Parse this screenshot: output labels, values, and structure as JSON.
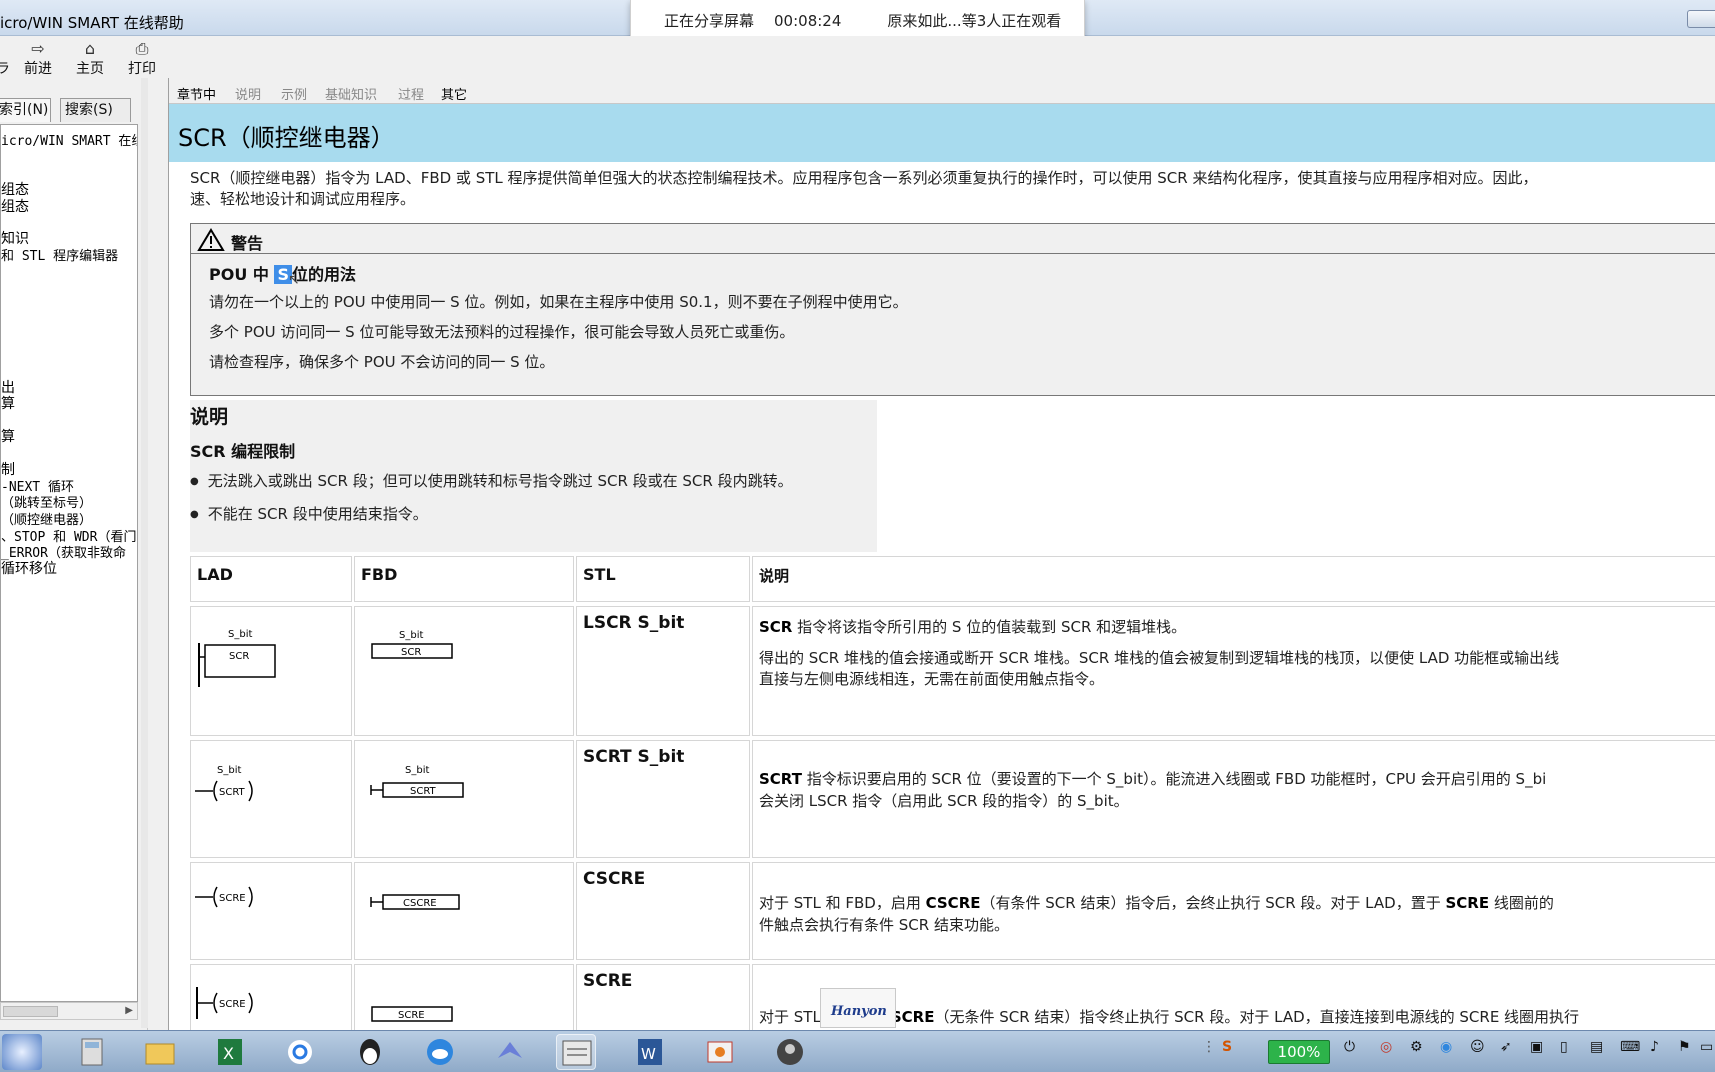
{
  "window": {
    "title": "icro/WIN SMART 在线帮助"
  },
  "share_bar": {
    "status": "正在分享屏幕",
    "elapsed": "00:08:24",
    "viewers": "原来如此...等3人正在观看"
  },
  "toolbar": {
    "back_label": "ラ",
    "forward_label": "前进",
    "home_label": "主页",
    "print_label": "打印"
  },
  "left_tabs": {
    "index": "索引(N)",
    "search": "搜索(S)"
  },
  "tree_items": [
    "icro/WIN SMART 在线",
    "组态",
    "组态",
    "知识",
    "和 STL 程序编辑器",
    "出",
    "算",
    "算",
    "制",
    "-NEXT 循环",
    "（跳转至标号）",
    "（顺控继电器）",
    "、STOP 和 WDR（看门",
    "_ERROR（获取非致命",
    "循环移位"
  ],
  "nav_tabs": [
    "章节中",
    "说明",
    "示例",
    "基础知识",
    "过程",
    "其它"
  ],
  "page_title": "SCR（顺控继电器）",
  "intro": {
    "line1": "SCR（顺控继电器）指令为 LAD、FBD 或 STL 程序提供简单但强大的状态控制编程技术。应用程序包含一系列必须重复执行的操作时，可以使用 SCR 来结构化程序，使其直接与应用程序相对应。因此，",
    "line2": "速、轻松地设计和调试应用程序。"
  },
  "warning": {
    "header": "警告",
    "title_pre": "POU 中",
    "title_hl": "S",
    "title_post": "位的用法",
    "line1": "请勿在一个以上的 POU 中使用同一 S 位。例如，如果在主程序中使用 S0.1，则不要在子例程中使用它。",
    "line2": "多个 POU 访问同一 S 位可能导致无法预料的过程操作，很可能会导致人员死亡或重伤。",
    "line3": "请检查程序，确保多个 POU 不会访问的同一 S 位。"
  },
  "description": {
    "heading": "说明",
    "subheading": "SCR 编程限制",
    "bullets": [
      "无法跳入或跳出 SCR 段；但可以使用跳转和标号指令跳过 SCR 段或在 SCR 段内跳转。",
      "不能在 SCR 段中使用结束指令。"
    ]
  },
  "table": {
    "headers": {
      "lad": "LAD",
      "fbd": "FBD",
      "stl": "STL",
      "desc": "说明"
    },
    "rows": [
      {
        "lad_label": "S_bit",
        "lad_box": "SCR",
        "fbd_label": "S_bit",
        "fbd_box": "SCR",
        "stl": "LSCR S_bit",
        "d1_b": "SCR",
        "d1": " 指令将该指令所引用的 S 位的值装载到 SCR 和逻辑堆栈。",
        "d2": "得出的 SCR 堆栈的值会接通或断开 SCR 堆栈。SCR 堆栈的值会被复制到逻辑堆栈的栈顶，以便使 LAD 功能框或输出线",
        "d3": "直接与左侧电源线相连，无需在前面使用触点指令。"
      },
      {
        "lad_label": "S_bit",
        "lad_coil": "SCRT",
        "fbd_label": "S_bit",
        "fbd_box": "SCRT",
        "stl": "SCRT S_bit",
        "d1_b": "SCRT",
        "d1": " 指令标识要启用的 SCR 位（要设置的下一个 S_bit）。能流进入线圈或 FBD 功能框时，CPU 会开启引用的 S_bi",
        "d2": "会关闭 LSCR 指令（启用此 SCR 段的指令）的 S_bit。"
      },
      {
        "lad_coil": "SCRE",
        "fbd_box": "CSCRE",
        "stl": "CSCRE",
        "d1_pre": "对于 STL 和 FBD，启用 ",
        "d1_b": "CSCRE",
        "d1_mid": "（有条件 SCR 结束）指令后，会终止执行 SCR 段。对于 LAD，置于 ",
        "d1_b2": "SCRE",
        "d1_post": " 线圈前的",
        "d2": "件触点会执行有条件 SCR 结束功能。"
      },
      {
        "lad_coil": "SCRE",
        "fbd_box": "SCRE",
        "stl": "SCRE",
        "d1_pre": "对于 STL 和 FBD，",
        "d1_b": "SCRE",
        "d1_post": "（无条件 SCR 结束）指令终止执行 SCR 段。对于 LAD，直接连接到电源线的 SCRE 线圈用执行"
      }
    ]
  },
  "watermark": "Hanyon",
  "taskbar": {
    "battery": "100%"
  }
}
